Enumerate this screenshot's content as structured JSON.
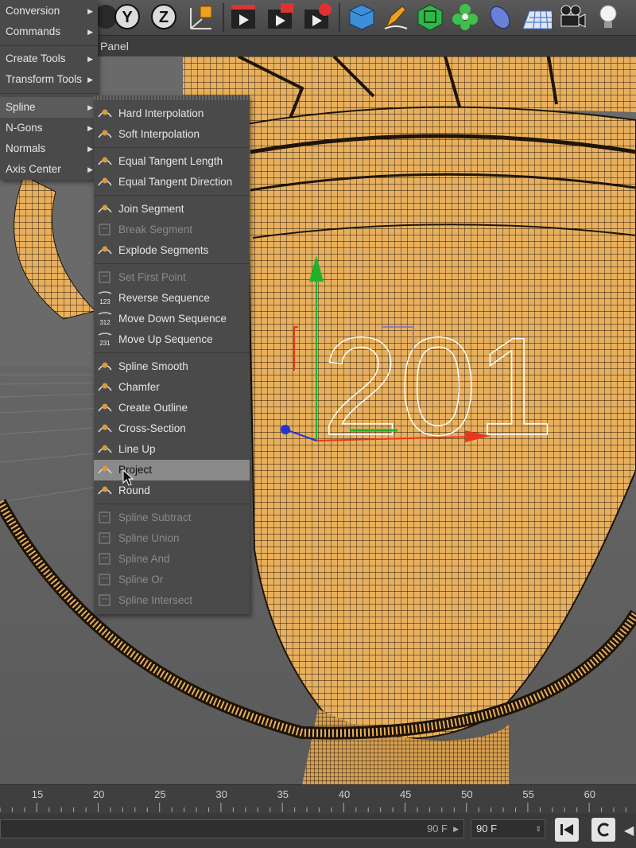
{
  "toolbar": {
    "axis_buttons": [
      "Y",
      "Z"
    ],
    "icons": [
      "axis-x-icon",
      "axis-y-icon",
      "axis-z-icon",
      "coordinate-system-icon",
      "render-view-icon",
      "render-picture-viewer-icon",
      "render-settings-icon",
      "cube-icon",
      "pen-icon",
      "subdivision-icon",
      "mograph-icon",
      "deformer-icon",
      "floor-icon",
      "camera-icon",
      "light-icon"
    ]
  },
  "panel_bar": {
    "label": "Panel"
  },
  "left_menu": {
    "items": [
      {
        "label": "Conversion",
        "submenu": true
      },
      {
        "label": "Commands",
        "submenu": true
      },
      {
        "label": "Create Tools",
        "submenu": true
      },
      {
        "label": "Transform Tools",
        "submenu": true
      },
      {
        "label": "Spline",
        "submenu": true,
        "active": true
      },
      {
        "label": "N-Gons",
        "submenu": true
      },
      {
        "label": "Normals",
        "submenu": true
      },
      {
        "label": "Axis Center",
        "submenu": true
      }
    ]
  },
  "spline_menu": {
    "items": [
      {
        "label": "Hard Interpolation",
        "icon": "hard-interpolation-icon"
      },
      {
        "label": "Soft Interpolation",
        "icon": "soft-interpolation-icon"
      },
      {
        "label": "Equal Tangent Length",
        "icon": "equal-tangent-length-icon"
      },
      {
        "label": "Equal Tangent Direction",
        "icon": "equal-tangent-direction-icon"
      },
      {
        "label": "Join Segment",
        "icon": "join-segment-icon"
      },
      {
        "label": "Break Segment",
        "icon": "break-segment-icon",
        "disabled": true
      },
      {
        "label": "Explode Segments",
        "icon": "explode-segments-icon"
      },
      {
        "label": "Set First Point",
        "icon": "set-first-point-icon",
        "disabled": true
      },
      {
        "label": "Reverse Sequence",
        "icon": "reverse-sequence-icon",
        "badge": "123"
      },
      {
        "label": "Move Down Sequence",
        "icon": "move-down-sequence-icon",
        "badge": "312"
      },
      {
        "label": "Move Up Sequence",
        "icon": "move-up-sequence-icon",
        "badge": "231"
      },
      {
        "label": "Spline Smooth",
        "icon": "spline-smooth-icon"
      },
      {
        "label": "Chamfer",
        "icon": "chamfer-icon"
      },
      {
        "label": "Create Outline",
        "icon": "create-outline-icon"
      },
      {
        "label": "Cross-Section",
        "icon": "cross-section-icon"
      },
      {
        "label": "Line Up",
        "icon": "line-up-icon"
      },
      {
        "label": "Project",
        "icon": "project-icon",
        "highlight": true
      },
      {
        "label": "Round",
        "icon": "round-icon"
      },
      {
        "label": "Spline Subtract",
        "icon": "spline-subtract-icon",
        "disabled": true
      },
      {
        "label": "Spline Union",
        "icon": "spline-union-icon",
        "disabled": true
      },
      {
        "label": "Spline And",
        "icon": "spline-and-icon",
        "disabled": true
      },
      {
        "label": "Spline Or",
        "icon": "spline-or-icon",
        "disabled": true
      },
      {
        "label": "Spline Intersect",
        "icon": "spline-intersect-icon",
        "disabled": true
      }
    ]
  },
  "viewport": {
    "spline_text": "201",
    "mesh_color": "#e8b05e",
    "wire_color": "#1e1408"
  },
  "timeline": {
    "ticks": [
      "15",
      "20",
      "25",
      "30",
      "35",
      "40",
      "45",
      "50",
      "55",
      "60"
    ]
  },
  "bottom": {
    "frame_field_a": "90 F",
    "frame_field_b": "90 F"
  },
  "colors": {
    "menu_bg": "#4a4a4a",
    "menu_highlight": "#8a8a8a",
    "x_axis": "#e8381c",
    "y_axis": "#21b12a",
    "z_axis": "#2034d8"
  }
}
